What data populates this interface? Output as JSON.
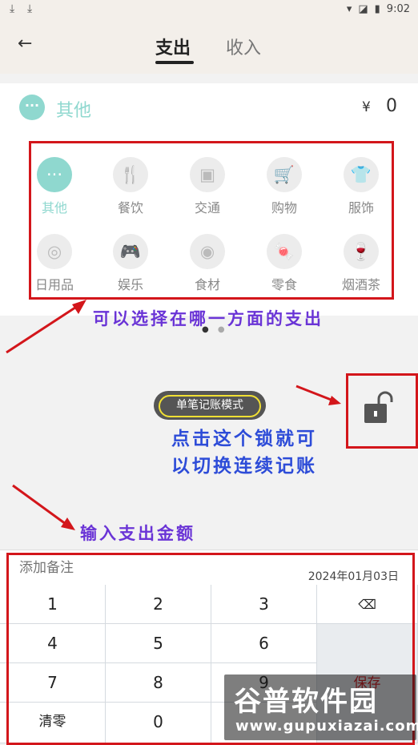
{
  "status_bar": {
    "time": "9:02"
  },
  "header": {
    "back_icon": "arrow-left-icon",
    "tabs": [
      {
        "label": "支出",
        "active": true
      },
      {
        "label": "收入",
        "active": false
      }
    ]
  },
  "selected": {
    "icon": "more-dots-icon",
    "name": "其他",
    "currency": "¥",
    "amount": "0"
  },
  "categories": [
    {
      "label": "其他",
      "icon": "more-dots-icon",
      "active": true
    },
    {
      "label": "餐饮",
      "icon": "fork-knife-icon"
    },
    {
      "label": "交通",
      "icon": "bus-icon"
    },
    {
      "label": "购物",
      "icon": "cart-icon"
    },
    {
      "label": "服饰",
      "icon": "shirt-icon"
    },
    {
      "label": "日用品",
      "icon": "tissue-roll-icon"
    },
    {
      "label": "娱乐",
      "icon": "gamepad-icon"
    },
    {
      "label": "食材",
      "icon": "meat-icon"
    },
    {
      "label": "零食",
      "icon": "candy-icon"
    },
    {
      "label": "烟酒茶",
      "icon": "wine-glass-icon"
    }
  ],
  "mode": {
    "label": "单笔记账模式",
    "lock_icon": "unlock-icon"
  },
  "annotations": {
    "category_hint": "可以选择在哪一方面的支出",
    "lock_hint_line1": "点击这个锁就可",
    "lock_hint_line2": "以切换连续记账",
    "amount_hint": "输入支出金额"
  },
  "note": {
    "placeholder": "添加备注",
    "date": "2024年01月03日"
  },
  "keypad": {
    "keys": [
      "1",
      "2",
      "3",
      "4",
      "5",
      "6",
      "7",
      "8",
      "9",
      "清零",
      "0"
    ],
    "backspace_icon": "backspace-icon",
    "save_label": "保存"
  },
  "watermark": {
    "logo": "谷普软件园",
    "url": "www.gupuxiazai.com"
  },
  "colors": {
    "accent": "#8fd8cf",
    "annotation_red": "#d3161b",
    "annotation_purple": "#6a34d6",
    "annotation_blue": "#2d4cd8"
  }
}
